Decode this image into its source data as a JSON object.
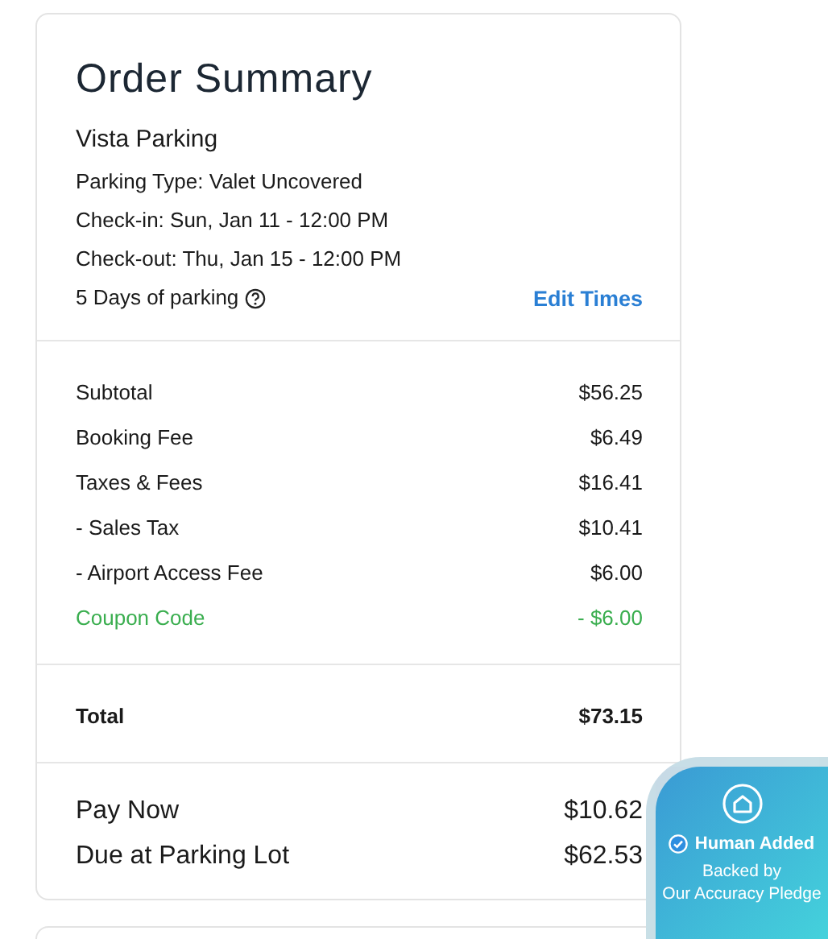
{
  "title": "Order Summary",
  "venue": "Vista Parking",
  "details": [
    "Parking Type: Valet Uncovered",
    "Check-in: Sun, Jan 11 - 12:00 PM",
    "Check-out: Thu, Jan 15 - 12:00 PM"
  ],
  "duration": "5 Days of parking",
  "edit_link": "Edit Times",
  "charges": [
    {
      "label": "Subtotal",
      "amount": "$56.25",
      "kind": "charge"
    },
    {
      "label": "Booking Fee",
      "amount": "$6.49",
      "kind": "charge"
    },
    {
      "label": "Taxes & Fees",
      "amount": "$16.41",
      "kind": "charge"
    },
    {
      "label": "- Sales Tax",
      "amount": "$10.41",
      "kind": "charge"
    },
    {
      "label": "- Airport Access Fee",
      "amount": "$6.00",
      "kind": "charge"
    },
    {
      "label": "Coupon Code",
      "amount": "- $6.00",
      "kind": "discount"
    }
  ],
  "total": {
    "label": "Total",
    "amount": "$73.15"
  },
  "payments": [
    {
      "label": "Pay Now",
      "amount": "$10.62"
    },
    {
      "label": "Due at Parking Lot",
      "amount": "$62.53"
    }
  ],
  "badge": {
    "title": "Human Added",
    "lines": [
      "Backed by",
      "Our Accuracy Pledge"
    ]
  }
}
